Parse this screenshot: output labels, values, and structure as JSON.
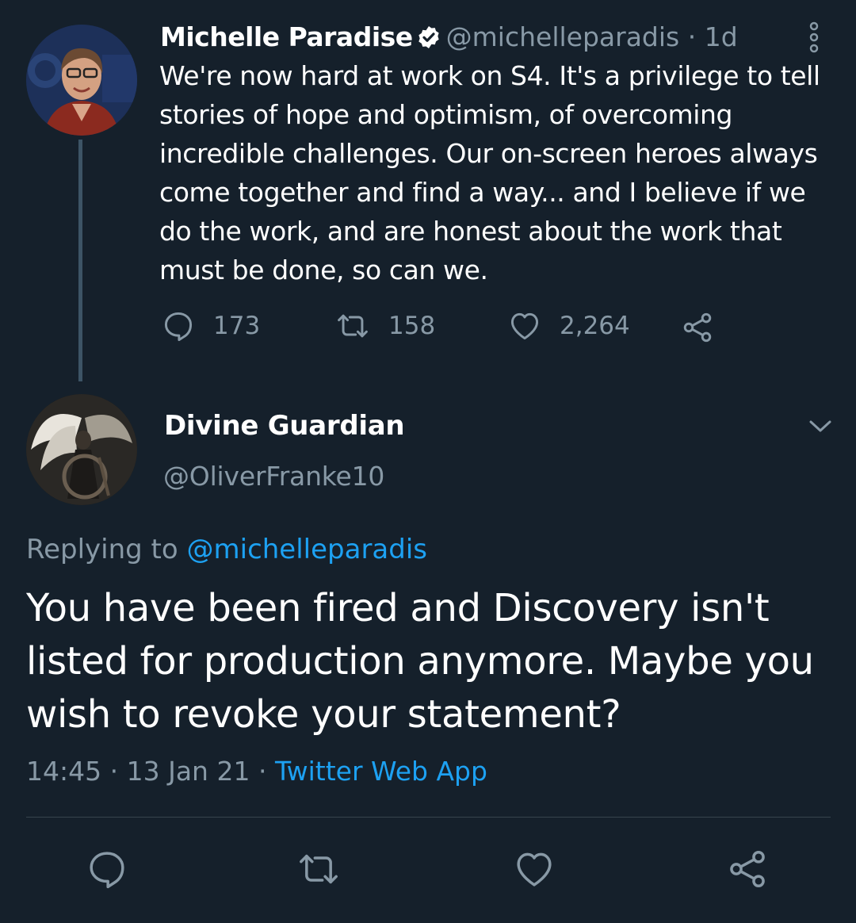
{
  "original_tweet": {
    "author_name": "Michelle Paradise",
    "handle": "@michelleparadis",
    "time_ago": "1d",
    "separator": "·",
    "text": "We're now hard at work on S4. It's a privilege to tell\nstories of hope and optimism, of overcoming\nincredible challenges. Our on-screen heroes always\ncome together and find a way... and I believe if we\ndo the work, and are honest about the work that\nmust be done, so can we.",
    "stats": {
      "replies": "173",
      "retweets": "158",
      "likes": "2,264"
    },
    "icons": [
      "verified-icon",
      "more-icon",
      "reply-icon",
      "retweet-icon",
      "like-icon",
      "share-icon"
    ],
    "verified": true
  },
  "reply_tweet": {
    "author_name": "Divine Guardian",
    "handle": "@OliverFranke10",
    "replying_prefix": "Replying to",
    "replying_handle": "@michelleparadis",
    "text": "You have been fired and Discovery isn't\nlisted for production anymore. Maybe you\nwish to revoke your statement?",
    "time": "14:45",
    "date": "13 Jan 21",
    "source": "Twitter Web App",
    "separator": "·"
  },
  "bottom_actions": [
    "reply-icon",
    "retweet-icon",
    "like-icon",
    "share-icon"
  ],
  "colors": {
    "background": "#15202b",
    "text": "#ffffff",
    "muted": "#8899a6",
    "accent": "#1da1f2",
    "divider": "#38444d"
  }
}
